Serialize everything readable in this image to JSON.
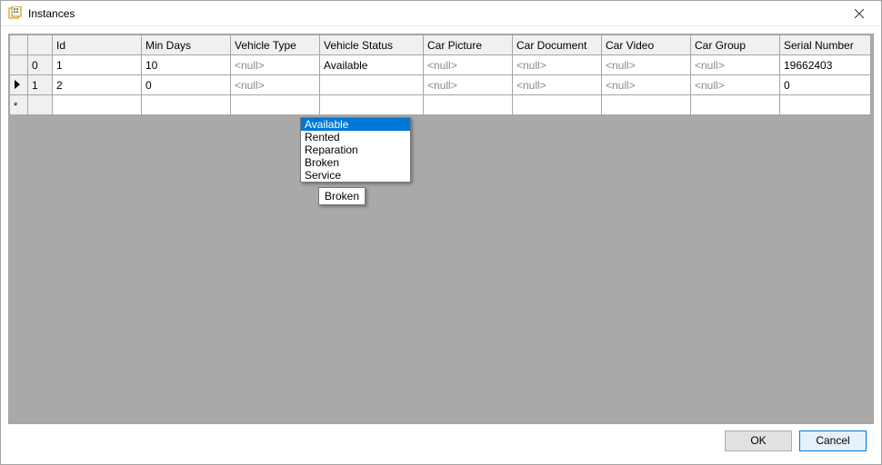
{
  "window": {
    "title": "Instances"
  },
  "grid": {
    "columns": {
      "id": "Id",
      "min_days": "Min Days",
      "vehicle_type": "Vehicle Type",
      "vehicle_status": "Vehicle Status",
      "car_picture": "Car Picture",
      "car_document": "Car Document",
      "car_video": "Car Video",
      "car_group": "Car Group",
      "serial_number": "Serial Number"
    },
    "null_text": "<null>",
    "rows": [
      {
        "row_number": "0",
        "marker": "none",
        "id": "1",
        "min_days": "10",
        "vehicle_type": null,
        "vehicle_status": "Available",
        "car_picture": null,
        "car_document": null,
        "car_video": null,
        "car_group": null,
        "serial_number": "19662403"
      },
      {
        "row_number": "1",
        "marker": "current",
        "id": "2",
        "min_days": "0",
        "vehicle_type": null,
        "vehicle_status": "",
        "vehicle_status_dropdown_open": true,
        "car_picture": null,
        "car_document": null,
        "car_video": null,
        "car_group": null,
        "serial_number": "0"
      },
      {
        "row_number": "",
        "marker": "new"
      }
    ],
    "vehicle_status_options": [
      "Available",
      "Rented",
      "Reparation",
      "Broken",
      "Service"
    ],
    "vehicle_status_selected_option": "Available"
  },
  "tooltip": {
    "text": "Broken"
  },
  "buttons": {
    "ok": "OK",
    "cancel": "Cancel"
  }
}
